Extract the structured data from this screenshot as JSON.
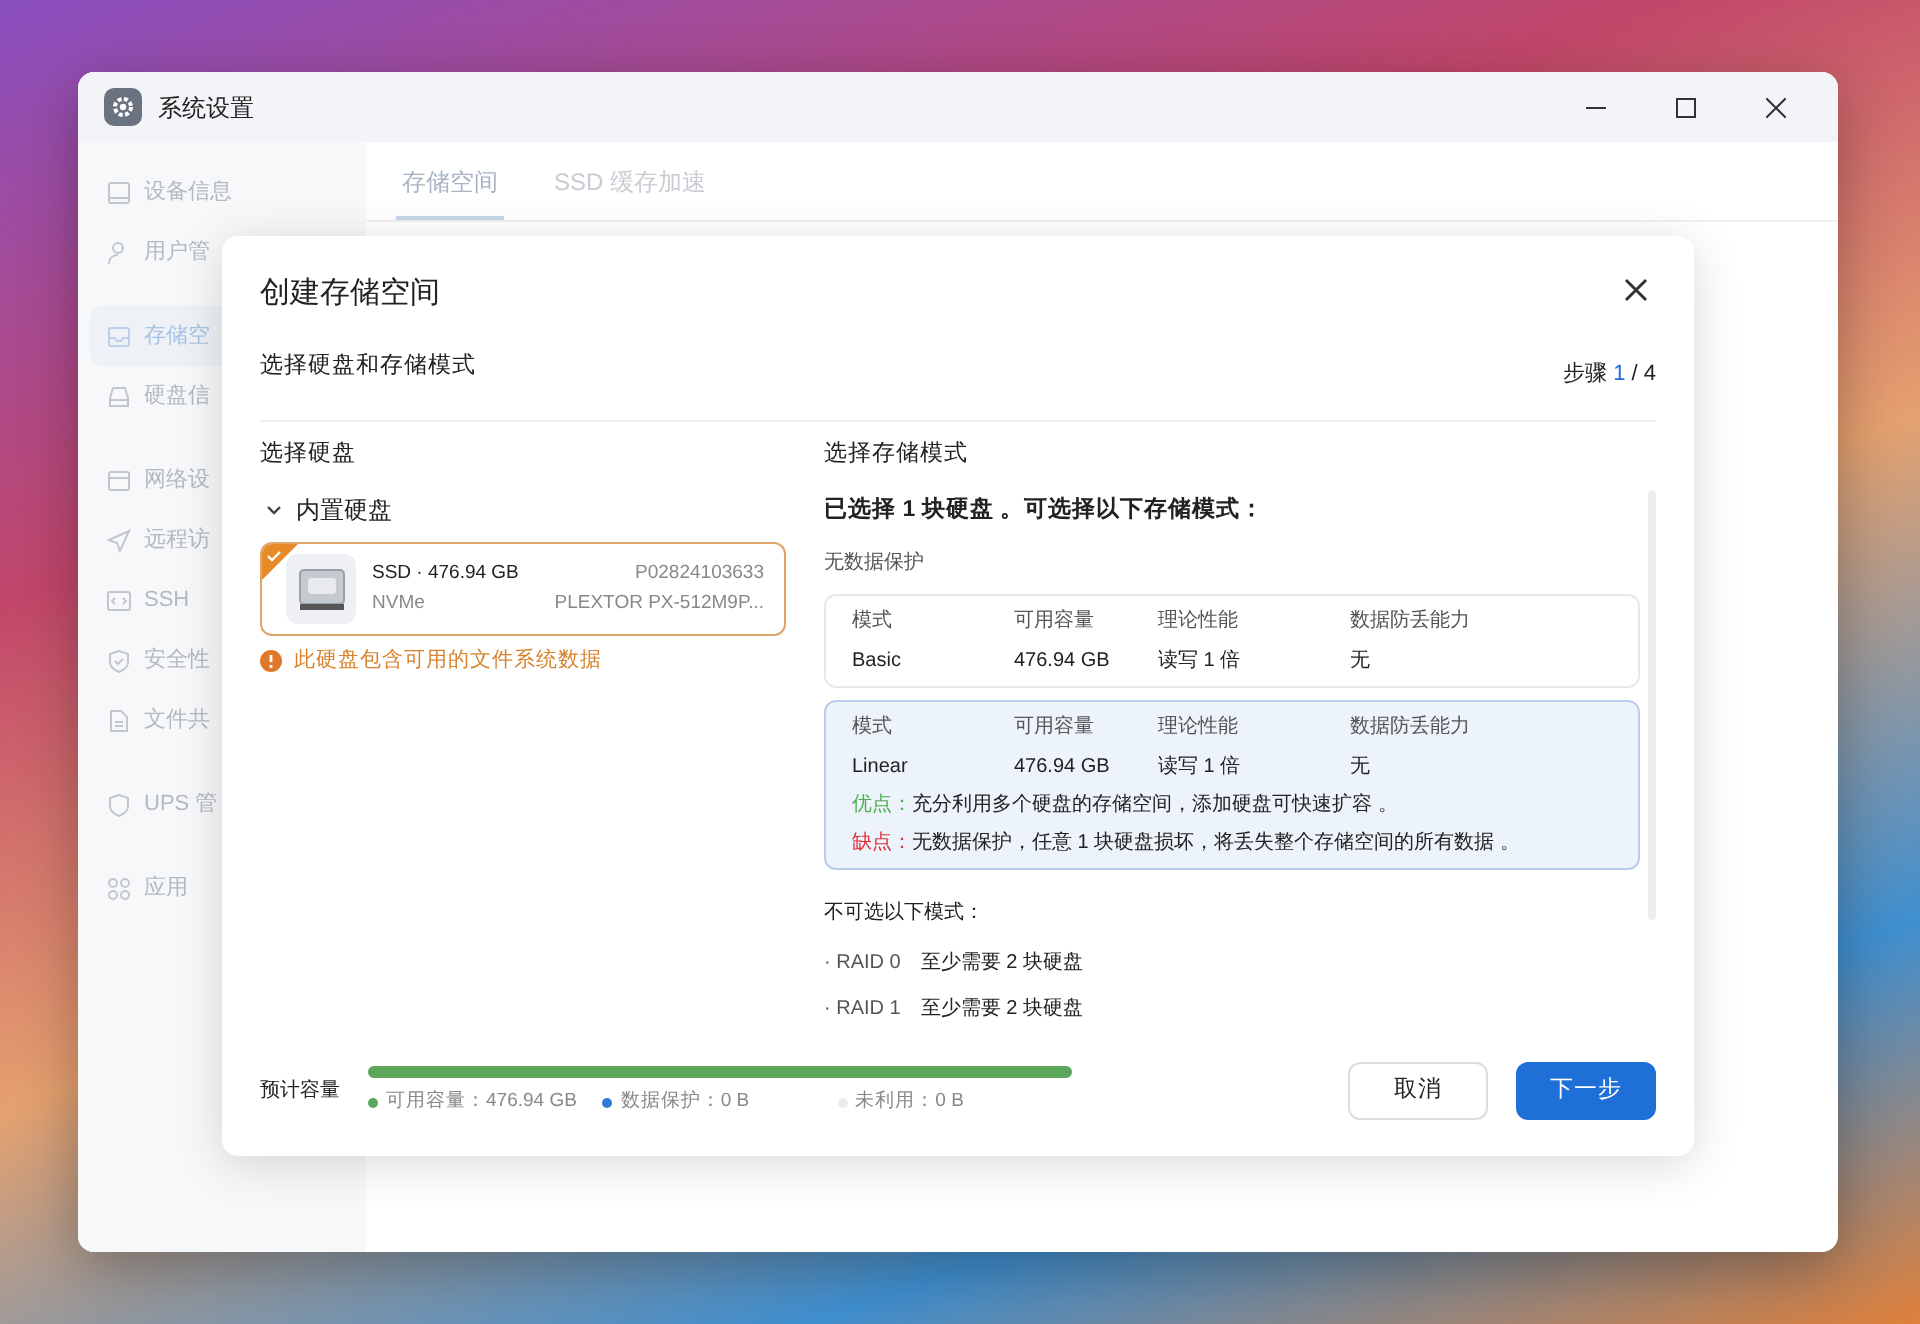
{
  "window": {
    "title": "系统设置"
  },
  "sidebar": {
    "groups": [
      {
        "items": [
          {
            "label": "设备信息",
            "selected": false
          },
          {
            "label": "用户管",
            "selected": false
          }
        ]
      },
      {
        "items": [
          {
            "label": "存储空",
            "selected": true
          },
          {
            "label": "硬盘信",
            "selected": false
          }
        ]
      },
      {
        "items": [
          {
            "label": "网络设",
            "selected": false
          },
          {
            "label": "远程访",
            "selected": false
          },
          {
            "label": "SSH",
            "selected": false
          },
          {
            "label": "安全性",
            "selected": false
          },
          {
            "label": "文件共",
            "selected": false
          }
        ]
      },
      {
        "items": [
          {
            "label": "UPS 管",
            "selected": false
          }
        ]
      },
      {
        "items": [
          {
            "label": "应用",
            "selected": false
          }
        ]
      }
    ]
  },
  "tabs": [
    {
      "label": "存储空间",
      "selected": true
    },
    {
      "label": "SSD 缓存加速",
      "selected": false
    }
  ],
  "dialog": {
    "title": "创建存储空间",
    "subtitle": "选择硬盘和存储模式",
    "step": {
      "label": "步骤",
      "current": "1",
      "total": "/ 4"
    },
    "disk_section": {
      "heading": "选择硬盘",
      "group": {
        "label": "内置硬盘",
        "expanded": true,
        "disks": [
          {
            "type_size": "SSD · 476.94 GB",
            "interface": "NVMe",
            "serial": "P02824103633",
            "model": "PLEXTOR PX-512M9P...",
            "selected": true,
            "warning": "此硬盘包含可用的文件系统数据"
          }
        ]
      }
    },
    "mode_section": {
      "heading": "选择存储模式",
      "summary": "已选择 1 块硬盘 。可选择以下存储模式：",
      "category": "无数据保护",
      "modes": [
        {
          "selected": false,
          "columns": [
            {
              "header": "模式",
              "value": "Basic"
            },
            {
              "header": "可用容量",
              "value": "476.94 GB"
            },
            {
              "header": "理论性能",
              "value": "读写 1 倍"
            },
            {
              "header": "数据防丢能力",
              "value": "无"
            }
          ]
        },
        {
          "selected": true,
          "columns": [
            {
              "header": "模式",
              "value": "Linear"
            },
            {
              "header": "可用容量",
              "value": "476.94 GB"
            },
            {
              "header": "理论性能",
              "value": "读写 1 倍"
            },
            {
              "header": "数据防丢能力",
              "value": "无"
            }
          ],
          "notes": [
            {
              "kind": "pro",
              "label": "优点：",
              "text": "充分利用多个硬盘的存储空间，添加硬盘可快速扩容 。"
            },
            {
              "kind": "con",
              "label": "缺点：",
              "text": "无数据保护，任意 1 块硬盘损坏，将丢失整个存储空间的所有数据 。"
            }
          ]
        }
      ],
      "unavailable_heading": "不可选以下模式：",
      "unavailable": [
        {
          "name": "· RAID 0",
          "requirement": "至少需要 2 块硬盘"
        },
        {
          "name": "· RAID 1",
          "requirement": "至少需要 2 块硬盘"
        }
      ]
    },
    "capacity": {
      "label": "预计容量",
      "level": 1,
      "legend": [
        {
          "label": "可用容量：476.94 GB",
          "color": "#5ba65b"
        },
        {
          "label": "数据保护：0 B",
          "color": "#2f7ad6"
        },
        {
          "label": "未利用：0 B",
          "color": "#ececec"
        }
      ]
    },
    "buttons": [
      {
        "label": "取消",
        "kind": "secondary"
      },
      {
        "label": "下一步",
        "kind": "primary"
      }
    ]
  }
}
